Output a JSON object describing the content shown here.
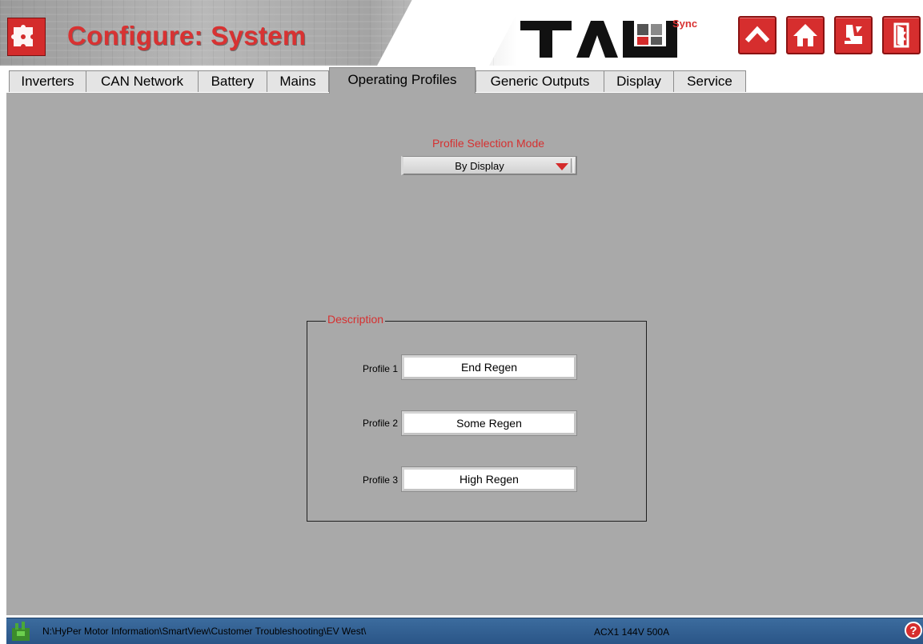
{
  "header": {
    "title": "Configure: System",
    "brand_sync": "Sync",
    "buttons": [
      "up-icon",
      "home-icon",
      "chair-icon",
      "exit-icon"
    ]
  },
  "tabs": [
    {
      "label": "Inverters",
      "active": false
    },
    {
      "label": "CAN Network",
      "active": false
    },
    {
      "label": "Battery",
      "active": false
    },
    {
      "label": "Mains",
      "active": false
    },
    {
      "label": "Operating Profiles",
      "active": true
    },
    {
      "label": "Generic Outputs",
      "active": false
    },
    {
      "label": "Display",
      "active": false
    },
    {
      "label": "Service",
      "active": false
    }
  ],
  "profile_selection": {
    "label": "Profile Selection Mode",
    "value": "By Display"
  },
  "description": {
    "legend": "Description",
    "profiles": [
      {
        "label": "Profile 1",
        "value": "End Regen"
      },
      {
        "label": "Profile 2",
        "value": "Some Regen"
      },
      {
        "label": "Profile 3",
        "value": "High Regen"
      }
    ]
  },
  "status": {
    "path": "N:\\HyPer Motor Information\\SmartView\\Customer Troubleshooting\\EV West\\",
    "device": "ACX1 144V 500A",
    "help_symbol": "?"
  },
  "colors": {
    "accent_red": "#d42b2b",
    "panel_gray": "#a9a9a9",
    "status_blue": "#2a5587"
  }
}
